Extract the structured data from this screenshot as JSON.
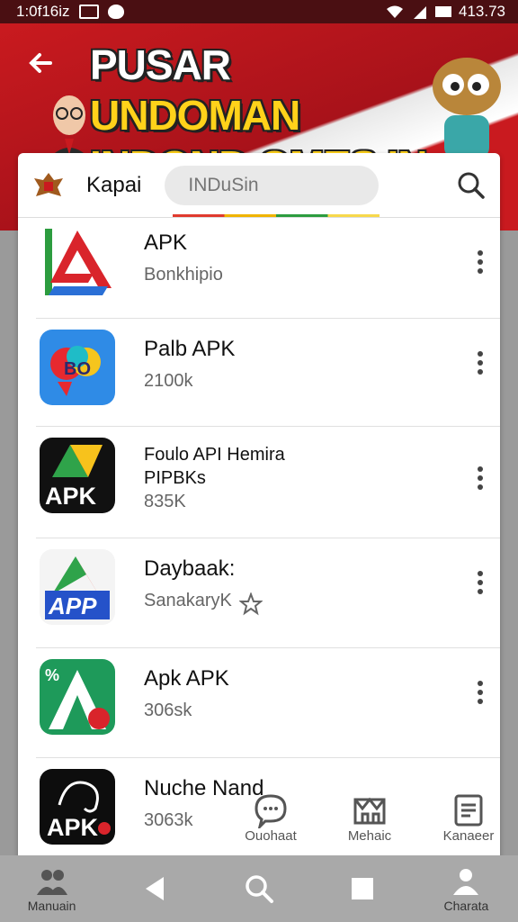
{
  "status": {
    "time": "1:0f16iz",
    "right": "413.73"
  },
  "banner": {
    "title_line1_white": "PUSAR ",
    "title_line1_yellow": "UNDOMAN",
    "title_line2": "INDOND OMES.IN"
  },
  "search": {
    "label": "Kapai",
    "placeholder": "INDuSin"
  },
  "apps": [
    {
      "name": "APK",
      "sub": "Bonkhipio",
      "icon": "red-blue-a-icon"
    },
    {
      "name": "Palb APK",
      "sub": "2100k",
      "icon": "colorful-blob-icon"
    },
    {
      "name": "Foulo API Hemira\nPIPBKs",
      "sub": "835K",
      "icon": "apk-black-icon"
    },
    {
      "name": "Daybaak:",
      "sub": "SanakaryK",
      "icon": "app-blue-icon"
    },
    {
      "name": "Apk  APK",
      "sub": "306sk",
      "icon": "green-a-icon"
    },
    {
      "name": "Nuche Nand",
      "sub": "3063k",
      "icon": "apk-elephant-icon"
    }
  ],
  "bottom_tabs": [
    {
      "label": "Ouohaat",
      "icon": "chat-bubble-icon"
    },
    {
      "label": "Mehaic",
      "icon": "store-icon"
    },
    {
      "label": "Kanaeer",
      "icon": "document-icon"
    }
  ],
  "nav": [
    {
      "label": "Manuain",
      "icon": "people-icon"
    },
    {
      "label": "",
      "icon": "back-triangle-icon"
    },
    {
      "label": "",
      "icon": "search-icon"
    },
    {
      "label": "",
      "icon": "square-icon"
    },
    {
      "label": "Charata",
      "icon": "person-icon"
    }
  ],
  "colors": {
    "banner_red": "#c91a1f",
    "title_yellow": "#ffd21a",
    "status_bg": "#4a0f12"
  }
}
